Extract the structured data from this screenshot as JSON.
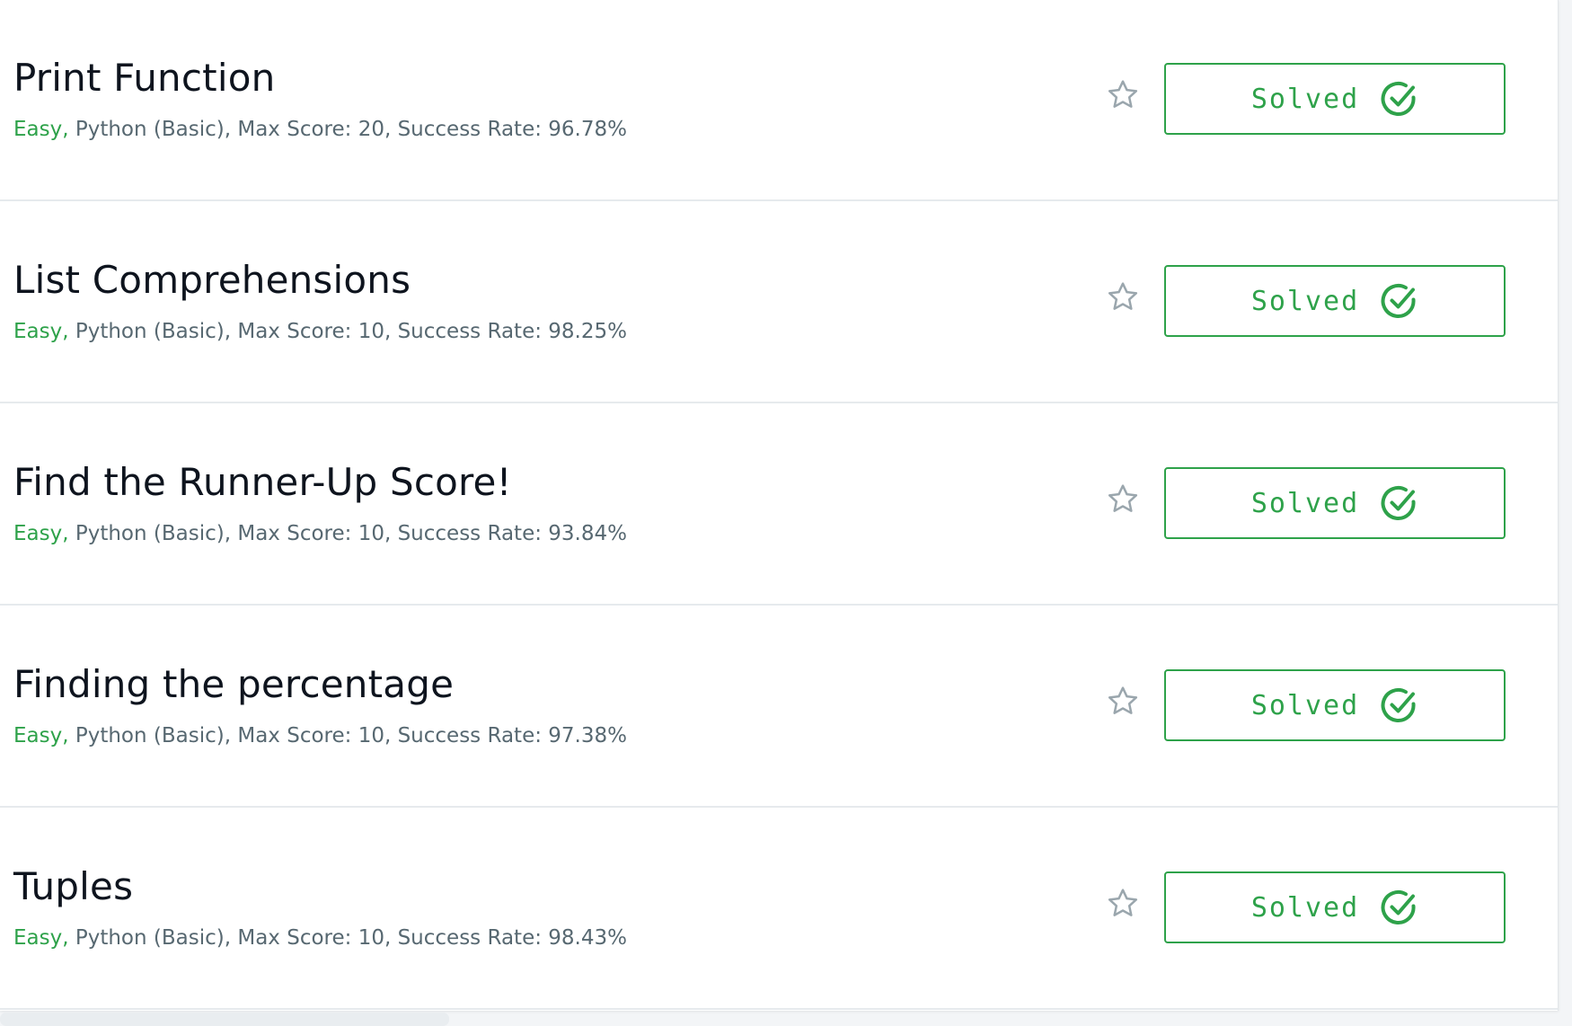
{
  "challenges": [
    {
      "title": "Print Function",
      "difficulty": "Easy,",
      "details": " Python (Basic), Max Score: 20, Success Rate: 96.78%",
      "status_label": "Solved"
    },
    {
      "title": "List Comprehensions",
      "difficulty": "Easy,",
      "details": " Python (Basic), Max Score: 10, Success Rate: 98.25%",
      "status_label": "Solved"
    },
    {
      "title": "Find the Runner-Up Score!",
      "difficulty": "Easy,",
      "details": " Python (Basic), Max Score: 10, Success Rate: 93.84%",
      "status_label": "Solved"
    },
    {
      "title": "Finding the percentage",
      "difficulty": "Easy,",
      "details": " Python (Basic), Max Score: 10, Success Rate: 97.38%",
      "status_label": "Solved"
    },
    {
      "title": "Tuples",
      "difficulty": "Easy,",
      "details": " Python (Basic), Max Score: 10, Success Rate: 98.43%",
      "status_label": "Solved"
    }
  ],
  "icons": {
    "bookmark": "star-outline-icon",
    "solved": "check-circle-icon"
  },
  "colors": {
    "accent": "#2ea24a",
    "title": "#0e141e",
    "meta": "#576871",
    "star": "#9aa6ad"
  }
}
